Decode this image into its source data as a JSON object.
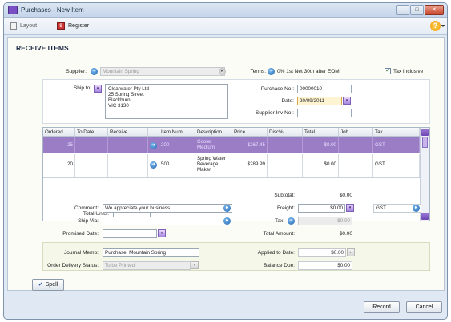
{
  "window": {
    "title": "Purchases - New Item"
  },
  "toolbar": {
    "layout_label": "Layout",
    "register_label": "Register"
  },
  "heading": "RECEIVE ITEMS",
  "header": {
    "supplier_label": "Supplier:",
    "supplier_value": "Mountain Spring",
    "terms_label": "Terms:",
    "terms_value": "0% 1st Net 30th after EOM",
    "tax_inclusive_label": "Tax Inclusive",
    "tax_inclusive_checked": true
  },
  "shipping": {
    "ship_to_label": "Ship to:",
    "ship_to_lines": [
      "Clearwater Pty Ltd",
      "25 Spring Street",
      "Blackburn",
      "VIC 3130"
    ],
    "purchase_no_label": "Purchase No.:",
    "purchase_no_value": "00000010",
    "date_label": "Date:",
    "date_value": "20/09/2011",
    "supplier_inv_label": "Supplier Inv No.:",
    "supplier_inv_value": ""
  },
  "grid": {
    "columns": [
      "Ordered",
      "To Date",
      "Receive",
      "",
      "Item Num...",
      "Description",
      "Price",
      "Disc%",
      "Total",
      "Job",
      "Tax"
    ],
    "rows": [
      {
        "ordered": "25",
        "to_date": "",
        "receive": "",
        "item": "200",
        "description": "Cooler Medium",
        "price": "$267.45",
        "disc": "",
        "total": "$0.00",
        "job": "",
        "tax": "GST"
      },
      {
        "ordered": "20",
        "to_date": "",
        "receive": "",
        "item": "500",
        "description": "Spring Water Beverage Maker",
        "price": "$289.99",
        "disc": "",
        "total": "$0.00",
        "job": "",
        "tax": "GST"
      }
    ],
    "total_units_label": "Total Units:",
    "total_units_value": ""
  },
  "bottom": {
    "comment_label": "Comment:",
    "comment_value": "We appreciate your business.",
    "ship_via_label": "Ship Via:",
    "ship_via_value": "",
    "promised_date_label": "Promised Date:",
    "promised_date_value": "",
    "subtotal_label": "Subtotal:",
    "subtotal_value": "$0.00",
    "freight_label": "Freight:",
    "freight_value": "$0.00",
    "freight_tax_code": "GST",
    "tax_label": "Tax:",
    "tax_value": "$0.00",
    "total_amount_label": "Total Amount:",
    "total_amount_value": "$0.00",
    "journal_memo_label": "Journal Memo:",
    "journal_memo_value": "Purchase; Mountain Spring",
    "order_delivery_label": "Order Delivery Status:",
    "order_delivery_value": "To be Printed",
    "applied_label": "Applied to Date:",
    "applied_value": "$0.00",
    "balance_due_label": "Balance Due:",
    "balance_due_value": "$0.00"
  },
  "buttons": {
    "spell": "Spell",
    "record": "Record",
    "cancel": "Cancel"
  }
}
